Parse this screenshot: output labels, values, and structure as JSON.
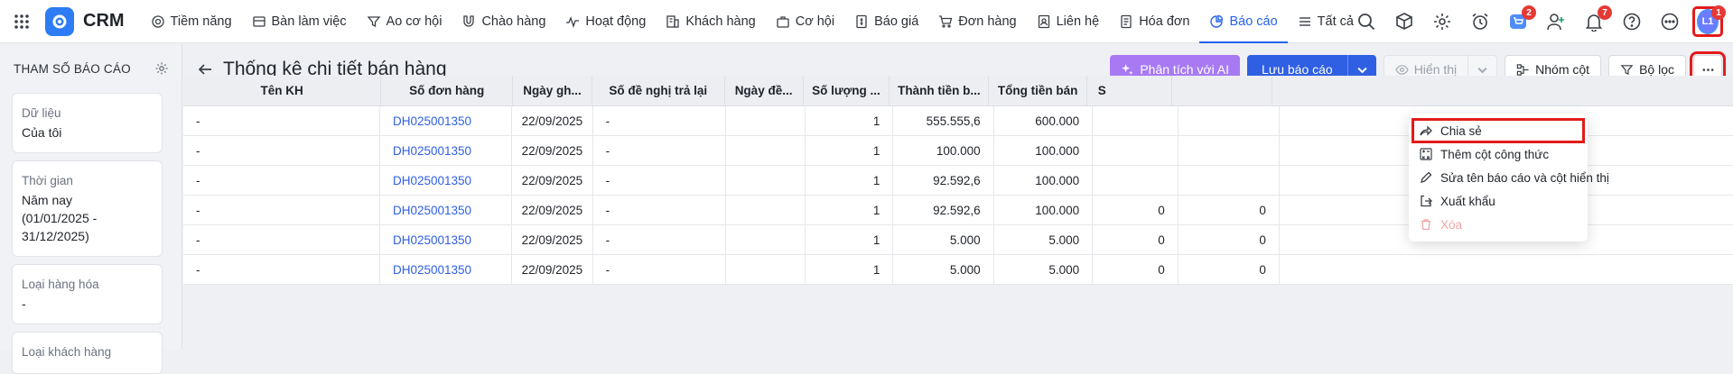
{
  "app": {
    "name": "CRM"
  },
  "nav": {
    "items": [
      {
        "label": "Tiềm năng",
        "icon": "target-icon"
      },
      {
        "label": "Bàn làm việc",
        "icon": "desk-icon"
      },
      {
        "label": "Ao cơ hội",
        "icon": "funnel-icon"
      },
      {
        "label": "Chào hàng",
        "icon": "magnet-icon"
      },
      {
        "label": "Hoạt động",
        "icon": "activity-icon"
      },
      {
        "label": "Khách hàng",
        "icon": "building-icon"
      },
      {
        "label": "Cơ hội",
        "icon": "briefcase-icon"
      },
      {
        "label": "Báo giá",
        "icon": "quote-icon"
      },
      {
        "label": "Đơn hàng",
        "icon": "cart-icon"
      },
      {
        "label": "Liên hệ",
        "icon": "contact-icon"
      },
      {
        "label": "Hóa đơn",
        "icon": "invoice-icon"
      },
      {
        "label": "Báo cáo",
        "icon": "pie-chart-icon",
        "active": true
      },
      {
        "label": "Tất cả",
        "icon": "menu-icon"
      }
    ],
    "badges": {
      "cart": "2",
      "bell": "7",
      "avatar": "1"
    },
    "avatar_initials": "L1"
  },
  "sidebar": {
    "title": "THAM SỐ BÁO CÁO",
    "params": [
      {
        "label": "Dữ liệu",
        "value": "Của tôi"
      },
      {
        "label": "Thời gian",
        "value": "Năm nay",
        "value2": "(01/01/2025 - 31/12/2025)"
      },
      {
        "label": "Loại hàng hóa",
        "value": "-"
      },
      {
        "label": "Loại khách hàng",
        "value": ""
      }
    ]
  },
  "toolbar": {
    "title": "Thống kê chi tiết bán hàng",
    "ai_label": "Phân tích với AI",
    "save_label": "Lưu báo cáo",
    "show_label": "Hiển thị",
    "group_label": "Nhóm cột",
    "filter_label": "Bộ lọc"
  },
  "table": {
    "columns": [
      "Tên KH",
      "Số đơn hàng",
      "Ngày gh...",
      "Số đề nghị trả lại",
      "Ngày đề...",
      "Số lượng ...",
      "Thành tiền b...",
      "Tổng tiền bán",
      "S",
      "",
      ""
    ],
    "rows": [
      [
        "-",
        "DH025001350",
        "22/09/2025",
        "-",
        "",
        "1",
        "555.555,6",
        "600.000",
        "",
        "",
        ""
      ],
      [
        "-",
        "DH025001350",
        "22/09/2025",
        "-",
        "",
        "1",
        "100.000",
        "100.000",
        "",
        "",
        ""
      ],
      [
        "-",
        "DH025001350",
        "22/09/2025",
        "-",
        "",
        "1",
        "92.592,6",
        "100.000",
        "",
        "",
        ""
      ],
      [
        "-",
        "DH025001350",
        "22/09/2025",
        "-",
        "",
        "1",
        "92.592,6",
        "100.000",
        "0",
        "0",
        ""
      ],
      [
        "-",
        "DH025001350",
        "22/09/2025",
        "-",
        "",
        "1",
        "5.000",
        "5.000",
        "0",
        "0",
        ""
      ],
      [
        "-",
        "DH025001350",
        "22/09/2025",
        "-",
        "",
        "1",
        "5.000",
        "5.000",
        "0",
        "0",
        ""
      ]
    ]
  },
  "menu": {
    "items": [
      {
        "label": "Chia sẻ",
        "icon": "share-icon"
      },
      {
        "label": "Thêm cột công thức",
        "icon": "formula-icon"
      },
      {
        "label": "Sửa tên báo cáo và cột hiển thị",
        "icon": "pencil-icon"
      },
      {
        "label": "Xuất khẩu",
        "icon": "export-icon"
      },
      {
        "label": "Xóa",
        "icon": "trash-icon"
      }
    ]
  }
}
